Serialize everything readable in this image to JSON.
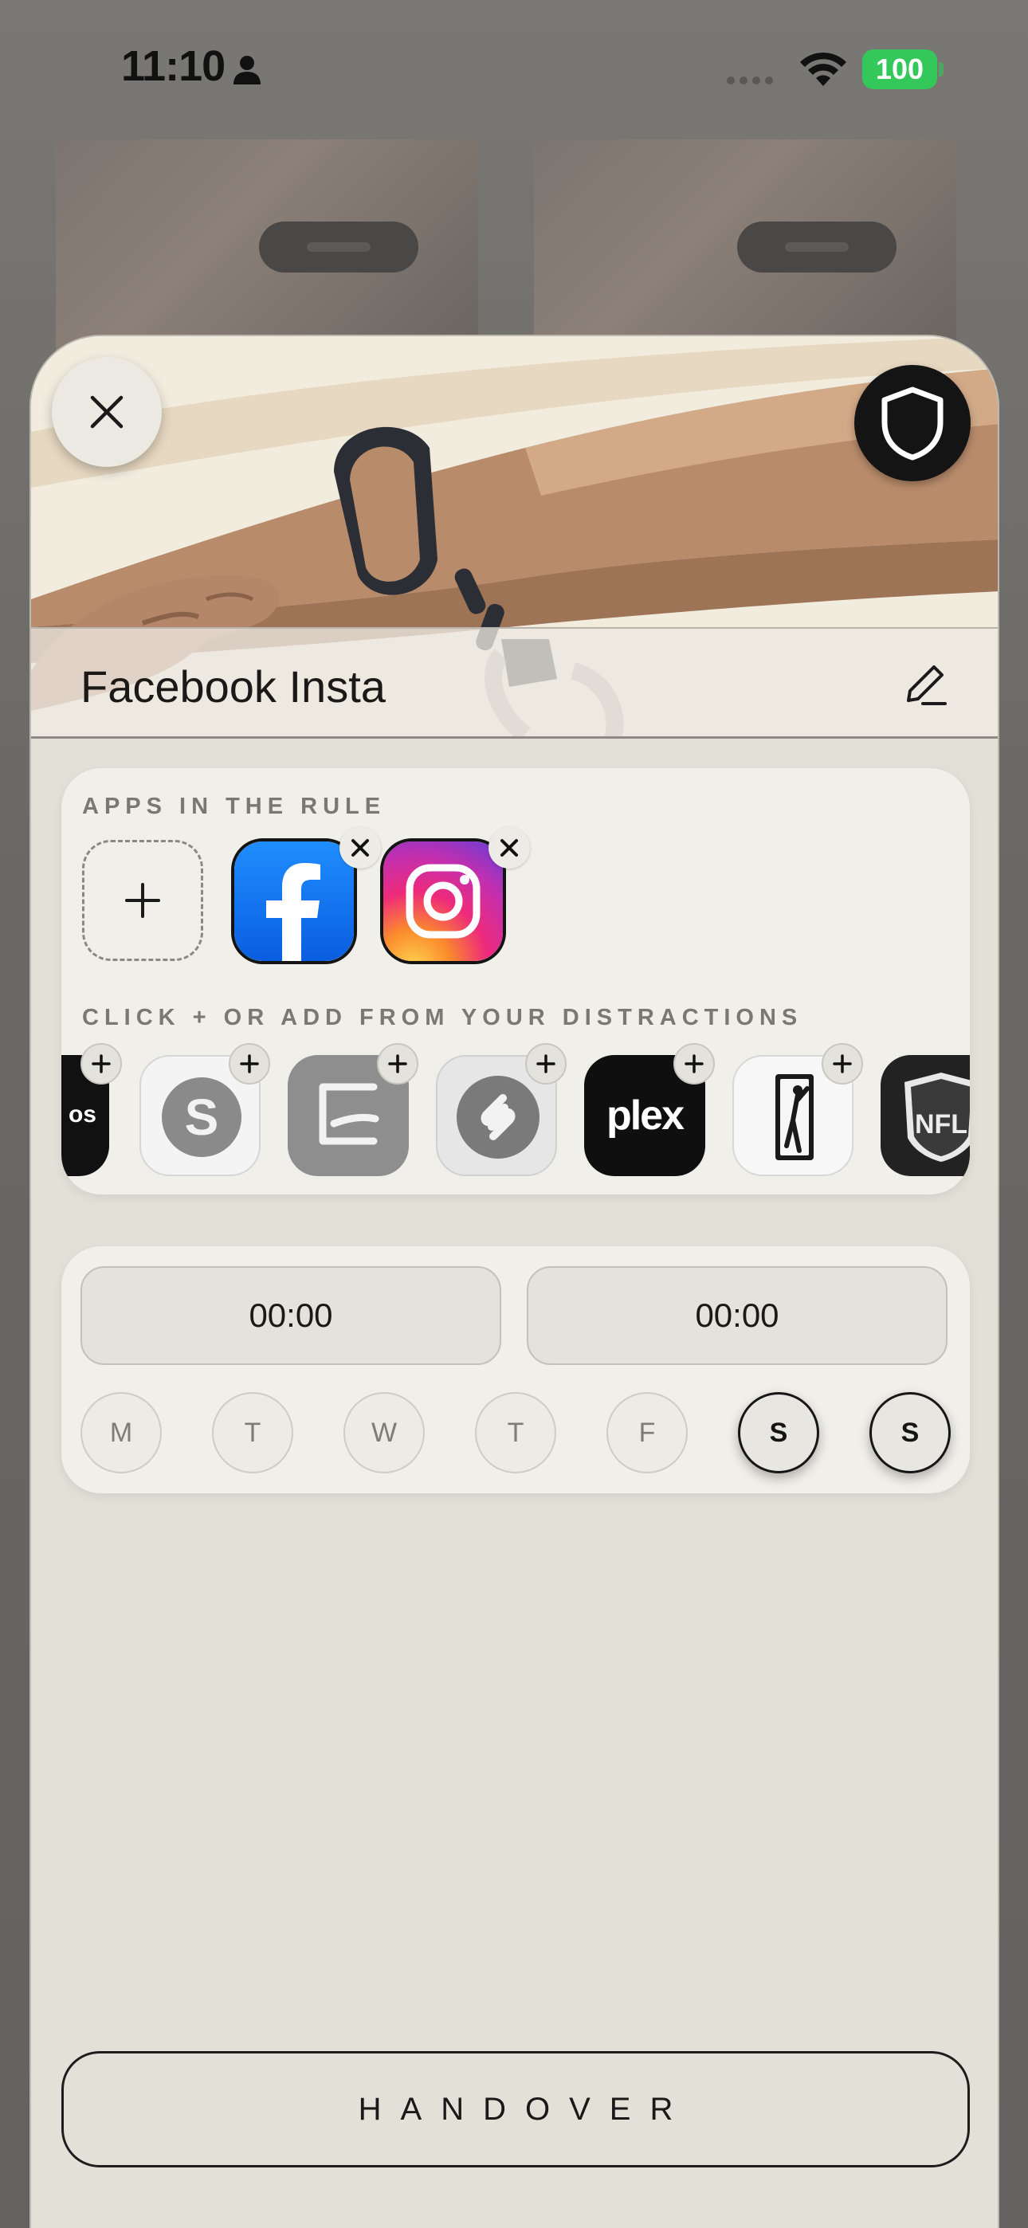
{
  "status_bar": {
    "time": "11:10",
    "battery": "100"
  },
  "sheet": {
    "title": "Facebook Insta"
  },
  "apps_section": {
    "label": "APPS IN THE RULE",
    "apps": [
      {
        "name": "Facebook",
        "icon": "facebook-app-icon"
      },
      {
        "name": "Instagram",
        "icon": "instagram-app-icon"
      }
    ]
  },
  "distractions_section": {
    "label": "CLICK + OR ADD FROM YOUR DISTRACTIONS",
    "apps": [
      {
        "name": "Photos app (partial)",
        "icon_text": "os"
      },
      {
        "name": "Skype",
        "icon": "skype-app-icon"
      },
      {
        "name": "Scanner",
        "icon": "scanner-app-icon"
      },
      {
        "name": "Shazam",
        "icon": "shazam-app-icon"
      },
      {
        "name": "Plex",
        "icon_text": "plex"
      },
      {
        "name": "PGA Tour",
        "icon": "pga-tour-app-icon"
      },
      {
        "name": "NFL",
        "icon_text": "NFL"
      }
    ]
  },
  "schedule": {
    "start_time": "00:00",
    "end_time": "00:00",
    "days": [
      {
        "label": "M",
        "active": false
      },
      {
        "label": "T",
        "active": false
      },
      {
        "label": "W",
        "active": false
      },
      {
        "label": "T",
        "active": false
      },
      {
        "label": "F",
        "active": false
      },
      {
        "label": "S",
        "active": true
      },
      {
        "label": "S",
        "active": true
      }
    ]
  },
  "handover_label": "HANDOVER",
  "colors": {
    "battery_green": "#34c759",
    "sheet_background": "#e3e0d8",
    "card_background": "#f0efe9",
    "facebook_blue": "#1877f2"
  }
}
